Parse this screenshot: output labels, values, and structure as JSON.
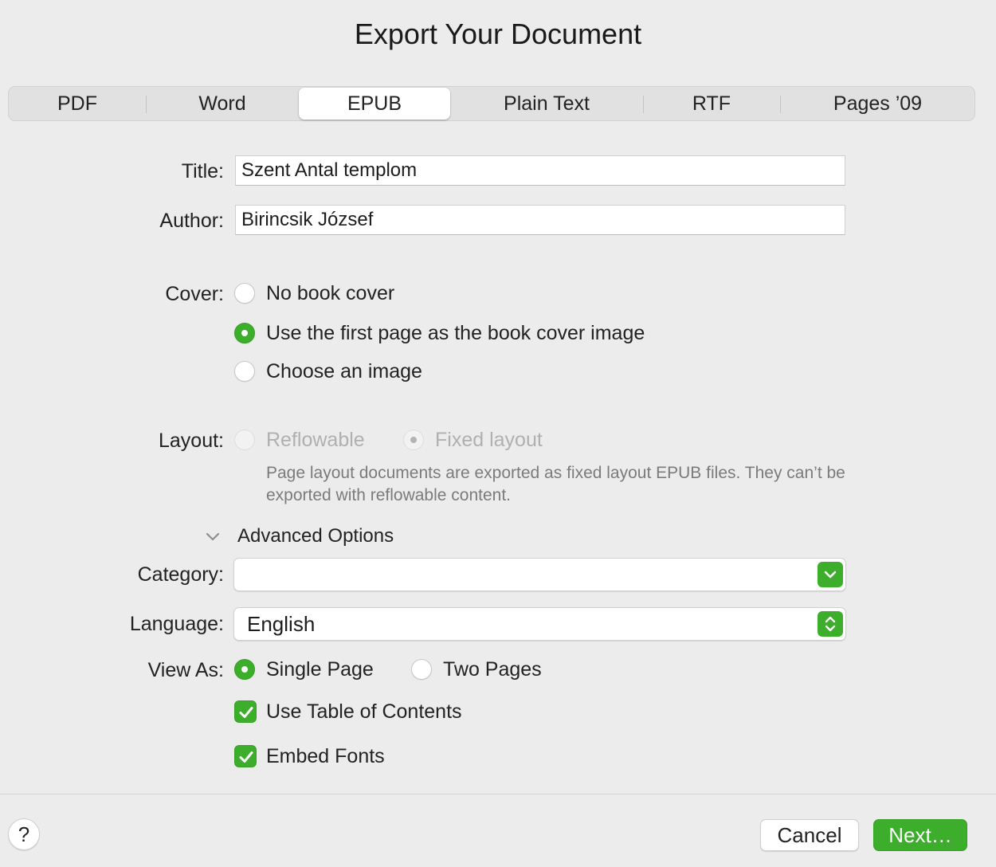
{
  "dialog": {
    "title": "Export Your Document"
  },
  "tabs": [
    {
      "label": "PDF",
      "active": false
    },
    {
      "label": "Word",
      "active": false
    },
    {
      "label": "EPUB",
      "active": true
    },
    {
      "label": "Plain Text",
      "active": false
    },
    {
      "label": "RTF",
      "active": false
    },
    {
      "label": "Pages ’09",
      "active": false
    }
  ],
  "form": {
    "title_label": "Title:",
    "title_value": "Szent Antal templom",
    "author_label": "Author:",
    "author_value": "Birincsik József",
    "cover_label": "Cover:",
    "cover_options": [
      {
        "label": "No book cover",
        "selected": false
      },
      {
        "label": "Use the first page as the book cover image",
        "selected": true
      },
      {
        "label": "Choose an image",
        "selected": false
      }
    ],
    "layout_label": "Layout:",
    "layout_options": [
      {
        "label": "Reflowable",
        "selected": false,
        "disabled": true
      },
      {
        "label": "Fixed layout",
        "selected": true,
        "disabled": true
      }
    ],
    "layout_note": "Page layout documents are exported as fixed layout EPUB files. They can’t be exported with reflowable content.",
    "advanced_label": "Advanced Options",
    "category_label": "Category:",
    "category_value": "",
    "language_label": "Language:",
    "language_value": "English",
    "view_as_label": "View As:",
    "view_as_options": [
      {
        "label": "Single Page",
        "selected": true
      },
      {
        "label": "Two Pages",
        "selected": false
      }
    ],
    "use_toc_label": "Use Table of Contents",
    "use_toc_checked": true,
    "embed_fonts_label": "Embed Fonts",
    "embed_fonts_checked": true
  },
  "footer": {
    "help_label": "?",
    "cancel_label": "Cancel",
    "next_label": "Next…"
  },
  "colors": {
    "accent": "#3dae2b",
    "background": "#ececec",
    "disabled_text": "#b0b0b0",
    "note_text": "#7b7b7b"
  }
}
